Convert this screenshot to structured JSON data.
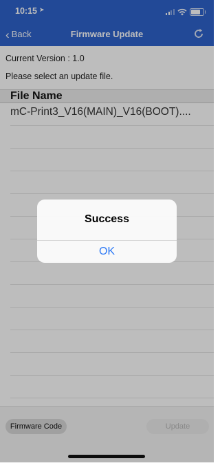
{
  "status_bar": {
    "time": "10:15"
  },
  "nav": {
    "back_label": "Back",
    "title": "Firmware Update",
    "refresh_icon": "refresh-icon"
  },
  "info": {
    "current_version": "Current Version : 1.0",
    "select_prompt": "Please select an update file."
  },
  "table": {
    "header": "File Name",
    "rows": [
      "mC-Print3_V16(MAIN)_V16(BOOT)...."
    ]
  },
  "buttons": {
    "firmware_code": "Firmware Code",
    "update": "Update"
  },
  "alert": {
    "title": "Success",
    "ok": "OK"
  },
  "colors": {
    "nav_bg": "#2f63cc",
    "alert_action": "#2f7af5"
  }
}
